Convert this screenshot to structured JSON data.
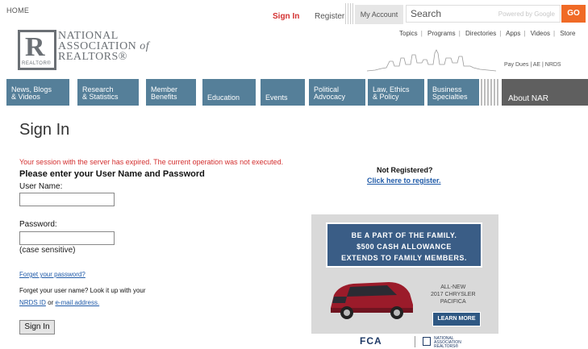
{
  "header": {
    "home": "HOME",
    "sign_in": "Sign In",
    "register": "Register",
    "my_account": "My Account",
    "search_placeholder": "Search",
    "powered_by": "Powered by Google",
    "go": "GO",
    "top_links": [
      "Topics",
      "Programs",
      "Directories",
      "Apps",
      "Videos",
      "Store"
    ],
    "pay_links": [
      "Pay Dues",
      "AE",
      "NRDS"
    ],
    "accent_color": "#f06a26"
  },
  "logo": {
    "line1": "NATIONAL",
    "line2": "ASSOCIATION",
    "line2_of": "of",
    "line3": "REALTORS®",
    "mark_small": "REALTOR®"
  },
  "nav": {
    "items": [
      {
        "line1": "News, Blogs",
        "line2": "& Videos"
      },
      {
        "line1": "Research",
        "line2": "& Statistics"
      },
      {
        "line1": "Member",
        "line2": "Benefits"
      },
      {
        "line1": "Education",
        "line2": ""
      },
      {
        "line1": "Events",
        "line2": ""
      },
      {
        "line1": "Political",
        "line2": "Advocacy"
      },
      {
        "line1": "Law, Ethics",
        "line2": "& Policy"
      },
      {
        "line1": "Business",
        "line2": "Specialties"
      }
    ],
    "about": "About NAR",
    "color": "#557f99"
  },
  "form": {
    "title": "Sign In",
    "session_message": "Your session with the server has expired. The current operation was not executed.",
    "instruction": "Please enter your User Name and Password",
    "username_label": "User Name:",
    "username_value": "",
    "password_label": "Password:",
    "password_value": "",
    "case_note": "(case sensitive)",
    "forgot_password": "Forget your password?",
    "forgot_username": "Forget your user name?  Look it up with your",
    "nrds_id": "NRDS ID",
    "or": "or",
    "email_address": "e-mail address.",
    "submit": "Sign In"
  },
  "register_box": {
    "title": "Not Registered?",
    "link": "Click here to register."
  },
  "ad": {
    "headline1": "BE A PART OF THE FAMILY.",
    "headline2": "$500 CASH ALLOWANCE",
    "headline3": "EXTENDS TO FAMILY MEMBERS.",
    "model1": "ALL-NEW",
    "model2": "2017 CHRYSLER",
    "model3": "PACIFICA",
    "cta": "LEARN MORE",
    "brand": "FCA",
    "partner1": "NATIONAL",
    "partner2": "ASSOCIATION",
    "partner3": "REALTORS®"
  }
}
